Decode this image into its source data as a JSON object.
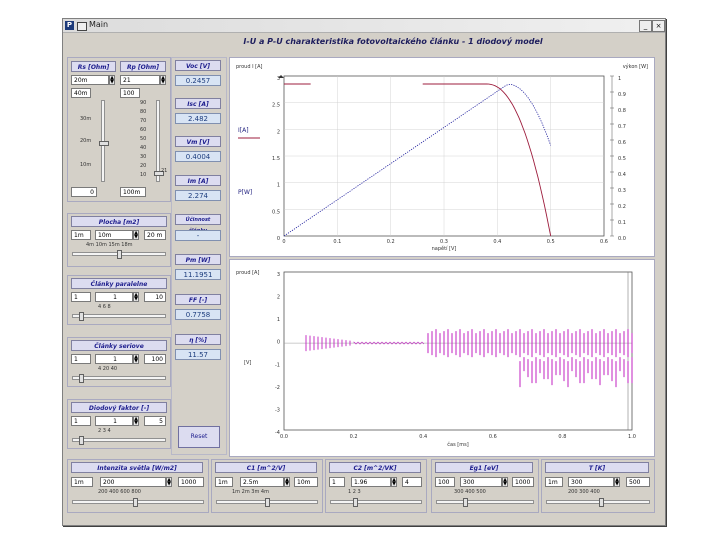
{
  "window": {
    "title": "Main",
    "icon_text": "P",
    "close": "×"
  },
  "heading": "I-U a P-U charakteristika fotovoltaického článku - 1 diodový model",
  "left": {
    "rs": {
      "label": "Rs [Ohm]",
      "value": "20m",
      "field": "40m",
      "ticks": [
        "30m",
        "20m",
        "10m"
      ],
      "bottom": "0"
    },
    "rp": {
      "label": "Rp [Ohm]",
      "value": "21",
      "field": "100",
      "ticks": [
        "90",
        "80",
        "70",
        "60",
        "50",
        "40",
        "30",
        "20",
        "10"
      ],
      "side": "21",
      "bottom": "100m"
    },
    "plocha": {
      "label": "Plocha [m2]",
      "min": "1m",
      "value": "10m",
      "max": "20 m",
      "ticks": "4m  10m  15m  18m"
    },
    "paralelne": {
      "label": "Články paralelne",
      "min": "1",
      "value": "1",
      "max": "10",
      "ticks": "4   6   8"
    },
    "seriove": {
      "label": "Články seriove",
      "min": "1",
      "value": "1",
      "max": "100",
      "ticks": "4   20   40"
    },
    "faktor": {
      "label": "Diodový faktor [-]",
      "min": "1",
      "value": "1",
      "max": "5",
      "ticks": "2   3   4"
    }
  },
  "mid": {
    "voc": {
      "label": "Voc [V]",
      "value": "0.2457"
    },
    "isc": {
      "label": "Isc [A]",
      "value": "2.482"
    },
    "vm": {
      "label": "Vm [V]",
      "value": "0.4004"
    },
    "im": {
      "label": "Im [A]",
      "value": "2.274"
    },
    "uc": {
      "label": "Účinnost článku",
      "value": "-"
    },
    "pm": {
      "label": "Pm [W]",
      "value": "11.1951"
    },
    "ff": {
      "label": "FF [-]",
      "value": "0.7758"
    },
    "n": {
      "label": "η [%]",
      "value": "11.57"
    },
    "button": "Reset"
  },
  "chart1": {
    "ylabel_left": "proud I [A]",
    "ylabel_right": "výkon [W]",
    "legend_i": "I[A]",
    "legend_p": "P[W]",
    "xlabel": "napětí [V]",
    "xticks": [
      "0",
      "0.1",
      "0.2",
      "0.3",
      "0.4",
      "0.5",
      "0.6"
    ],
    "yticks_left": [
      "3",
      "2.5",
      "2",
      "1.5",
      "1",
      "0.5",
      "0"
    ],
    "yticks_right": [
      "1",
      "0.9",
      "0.8",
      "0.7",
      "0.6",
      "0.5",
      "0.4",
      "0.3",
      "0.2",
      "0.1",
      "0.0"
    ]
  },
  "chart2": {
    "ylabel_top": "proud [A]",
    "ylabel_mid": "[V]",
    "xlabel": "čas [ms]",
    "yticks": [
      "3",
      "2",
      "1",
      "0",
      "-1",
      "-2",
      "-3",
      "-4"
    ],
    "xticks": [
      "0.0",
      "0.2",
      "0.4",
      "0.6",
      "0.8",
      "1.0"
    ]
  },
  "bottom": {
    "intenzita": {
      "label": "Intenzita světla [W/m2]",
      "min": "1m",
      "value": "200",
      "max": "1000",
      "ticks": "200   400   600   800"
    },
    "c1": {
      "label": "C1 [m^2/V]",
      "min": "1m",
      "value": "2.5m",
      "max": "10m",
      "ticks": "1m  2m  3m  4m"
    },
    "c2": {
      "label": "C2 [m^2/VK]",
      "min": "1",
      "value": "1.96",
      "max": "4",
      "ticks": "1   2   3"
    },
    "eg": {
      "label": "Eg1 [eV]",
      "min": "100",
      "value": "300",
      "max": "1000",
      "ticks": "300  400  500"
    },
    "t": {
      "label": "T [K]",
      "min": "1m",
      "value": "300",
      "max": "500",
      "ticks": "200  300  400"
    }
  },
  "colors": {
    "current_series": "#1d1d9d",
    "power_series": "#9d1d3d",
    "transient_series": "#c020c0",
    "accent_label": "#1d1d8d"
  }
}
